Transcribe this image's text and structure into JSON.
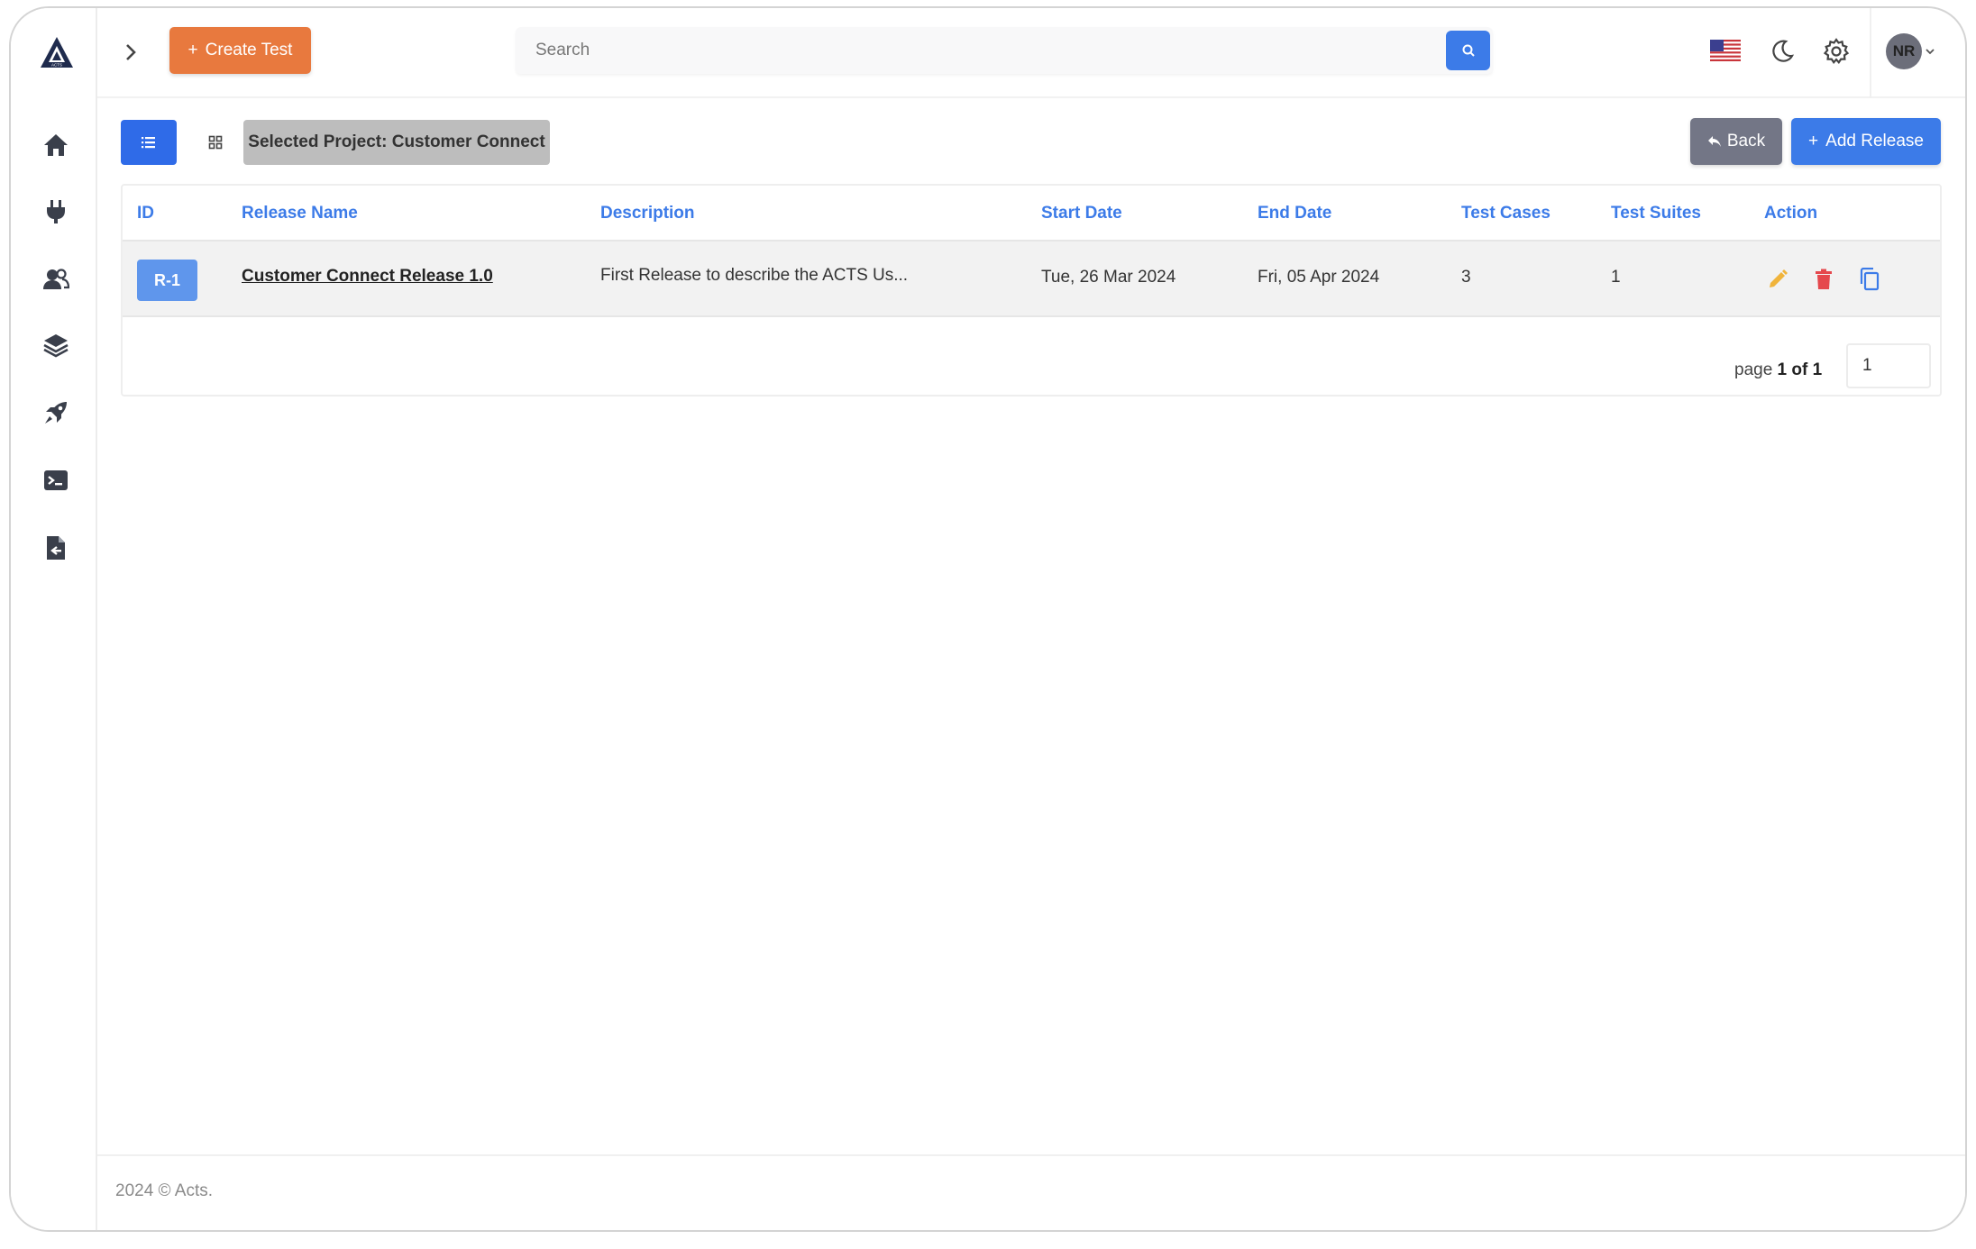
{
  "app": {
    "logo_text": "ACTS"
  },
  "topbar": {
    "create_label": "Create Test",
    "search_placeholder": "Search",
    "avatar_initials": "NR"
  },
  "sidebar": {
    "items": [
      {
        "name": "home",
        "icon": "home-icon"
      },
      {
        "name": "integrations",
        "icon": "plug-icon"
      },
      {
        "name": "users",
        "icon": "users-icon"
      },
      {
        "name": "projects",
        "icon": "layers-icon"
      },
      {
        "name": "releases",
        "icon": "rocket-icon"
      },
      {
        "name": "console",
        "icon": "terminal-icon"
      },
      {
        "name": "reports",
        "icon": "file-export-icon"
      }
    ]
  },
  "toolbar": {
    "selected_project": "Selected Project: Customer Connect",
    "back_label": "Back",
    "add_label": "Add Release"
  },
  "table": {
    "headers": [
      "ID",
      "Release Name",
      "Description",
      "Start Date",
      "End Date",
      "Test Cases",
      "Test Suites",
      "Action"
    ],
    "rows": [
      {
        "id": "R-1",
        "name": "Customer Connect Release 1.0",
        "description": "First Release to describe the ACTS Us...",
        "start_date": "Tue, 26 Mar 2024",
        "end_date": "Fri, 05 Apr 2024",
        "test_cases": "3",
        "test_suites": "1"
      }
    ]
  },
  "pagination": {
    "prefix": "page ",
    "current_of_total": "1 of 1",
    "page_input": "1"
  },
  "footer": {
    "text": "2024 © Acts."
  },
  "colors": {
    "primary": "#3c7be8",
    "create": "#e8793e",
    "back": "#737686",
    "edit": "#f0b43c",
    "delete": "#e5484d"
  }
}
